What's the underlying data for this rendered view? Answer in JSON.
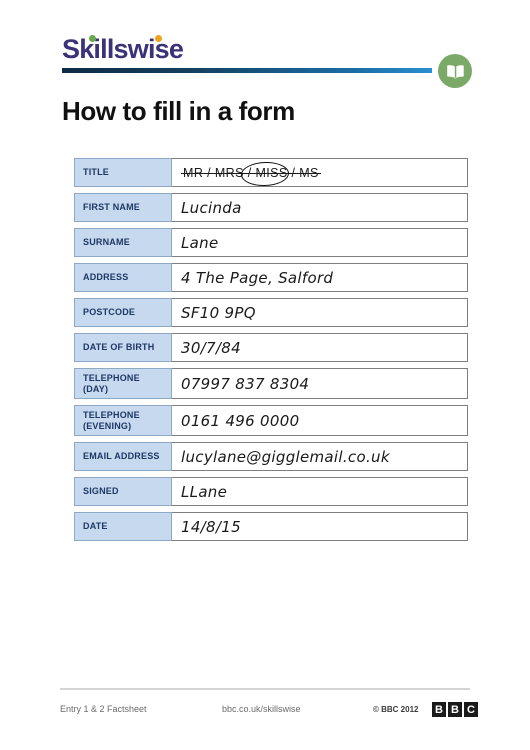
{
  "header": {
    "logo_text": "Skillswise",
    "badge_icon": "open-book-icon",
    "accent_purple": "#3b3279",
    "accent_green": "#7ba968",
    "dot_green": "#6aa84f",
    "dot_orange": "#f0a21c"
  },
  "document": {
    "title": "How to fill in a form"
  },
  "form": {
    "rows": [
      {
        "label": "TITLE",
        "label_sub": "",
        "type": "options",
        "options_text": "MR / MRS / MISS / MS",
        "circled_option": "MISS",
        "value": ""
      },
      {
        "label": "FIRST NAME",
        "label_sub": "",
        "type": "handwritten",
        "value": "Lucinda"
      },
      {
        "label": "SURNAME",
        "label_sub": "",
        "type": "handwritten",
        "value": "Lane"
      },
      {
        "label": "ADDRESS",
        "label_sub": "",
        "type": "handwritten",
        "value": "4 The Page, Salford"
      },
      {
        "label": "POSTCODE",
        "label_sub": "",
        "type": "handwritten",
        "value": "SF10 9PQ"
      },
      {
        "label": "DATE OF BIRTH",
        "label_sub": "",
        "type": "handwritten",
        "value": "30/7/84"
      },
      {
        "label": "TELEPHONE",
        "label_sub": "(DAY)",
        "type": "handwritten",
        "value": "07997 837 8304"
      },
      {
        "label": "TELEPHONE",
        "label_sub": "(EVENING)",
        "type": "handwritten",
        "value": "0161 496 0000"
      },
      {
        "label": "EMAIL ADDRESS",
        "label_sub": "",
        "type": "handwritten",
        "value": "lucylane@gigglemail.co.uk"
      },
      {
        "label": "SIGNED",
        "label_sub": "",
        "type": "handwritten",
        "value": "LLane"
      },
      {
        "label": "DATE",
        "label_sub": "",
        "type": "handwritten",
        "value": "14/8/15"
      }
    ]
  },
  "footer": {
    "left": "Entry 1 & 2 Factsheet",
    "middle": "bbc.co.uk/skillswise",
    "copyright": "© BBC 2012",
    "bbc_letters": [
      "B",
      "B",
      "C"
    ]
  }
}
